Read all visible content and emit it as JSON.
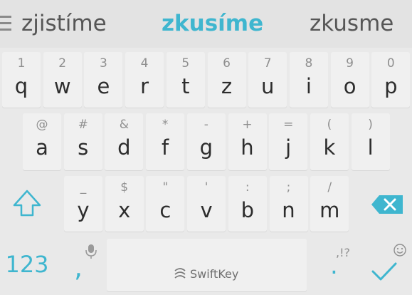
{
  "suggestions": {
    "left": "zjistíme",
    "center": "zkusíme",
    "right": "zkusme"
  },
  "colors": {
    "accent": "#3fb6cf",
    "key_face": "#f0f0f0",
    "key_text": "#2d2d2d",
    "hint_text": "#8f8f8f",
    "background": "#e9e9e9"
  },
  "rows": {
    "row1": [
      {
        "main": "q",
        "hint": "1"
      },
      {
        "main": "w",
        "hint": "2"
      },
      {
        "main": "e",
        "hint": "3"
      },
      {
        "main": "r",
        "hint": "4"
      },
      {
        "main": "t",
        "hint": "5"
      },
      {
        "main": "z",
        "hint": "6"
      },
      {
        "main": "u",
        "hint": "7"
      },
      {
        "main": "i",
        "hint": "8"
      },
      {
        "main": "o",
        "hint": "9"
      },
      {
        "main": "p",
        "hint": "0"
      }
    ],
    "row2": [
      {
        "main": "a",
        "hint": "@"
      },
      {
        "main": "s",
        "hint": "#"
      },
      {
        "main": "d",
        "hint": "&"
      },
      {
        "main": "f",
        "hint": "*"
      },
      {
        "main": "g",
        "hint": "-"
      },
      {
        "main": "h",
        "hint": "+"
      },
      {
        "main": "j",
        "hint": "="
      },
      {
        "main": "k",
        "hint": "("
      },
      {
        "main": "l",
        "hint": ")"
      }
    ],
    "row3": [
      {
        "main": "y",
        "hint": "_"
      },
      {
        "main": "x",
        "hint": "$"
      },
      {
        "main": "c",
        "hint": "\""
      },
      {
        "main": "v",
        "hint": "'"
      },
      {
        "main": "b",
        "hint": ":"
      },
      {
        "main": "n",
        "hint": ";"
      },
      {
        "main": "m",
        "hint": "/"
      }
    ]
  },
  "bottom": {
    "numbers_label": "123",
    "comma_main": ",",
    "comma_hint": "mic-icon",
    "spacebar_brand": "SwiftKey",
    "period_main": ".",
    "period_hint": ",!?",
    "emoji_icon": "smiley-icon",
    "enter_icon": "checkmark-icon"
  },
  "icons": {
    "menu": "hamburger-icon",
    "shift": "shift-arrow-icon",
    "backspace": "backspace-icon"
  }
}
